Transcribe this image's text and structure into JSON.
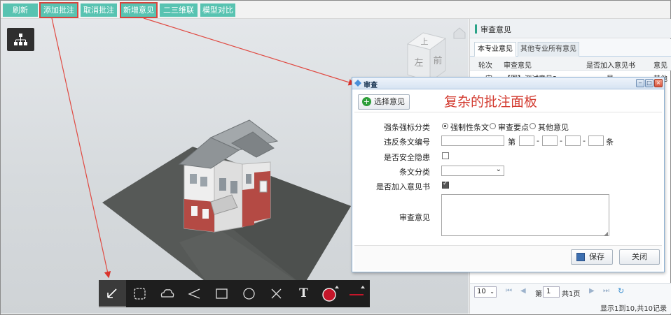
{
  "toolbar": {
    "buttons": [
      "刷新",
      "添加批注",
      "取消批注",
      "新增意见",
      "二三维联动",
      "模型对比"
    ],
    "accent": "#58c3b1",
    "highlight": "#d9453e"
  },
  "viewcube": {
    "top": "上",
    "left": "左",
    "front": "前"
  },
  "right_panel": {
    "title": "审查意见",
    "tabs": [
      "本专业意见",
      "其他专业所有意见"
    ],
    "columns": [
      "轮次",
      "审查意见",
      "是否加入意见书",
      "意见"
    ],
    "row": [
      "一审",
      "【图】测试意见2",
      "是",
      "其他"
    ],
    "pager": {
      "page_size": "10",
      "page_prefix": "第",
      "page_value": "1",
      "page_suffix": "共1页"
    },
    "status": "显示1到10,共10记录"
  },
  "dialog": {
    "title": "审查",
    "select_button": "选择意见",
    "annotation_note": "复杂的批注面板",
    "fields": {
      "category_label": "强条强标分类",
      "category_options": [
        "强制性条文",
        "审查要点",
        "其他意见"
      ],
      "clause_label": "违反条文编号",
      "clause_prefix": "第",
      "clause_sep": "-",
      "clause_suffix": "条",
      "safety_label": "是否安全隐患",
      "clause_type_label": "条文分类",
      "add_to_book_label": "是否加入意见书",
      "opinion_label": "审查意见"
    },
    "save_button": "保存",
    "close_button": "关闭"
  },
  "draw_tools": [
    "arrow",
    "lasso",
    "cloud",
    "polyline",
    "rectangle",
    "circle",
    "cross",
    "text",
    "color",
    "line-style"
  ],
  "draw_text_glyph": "T",
  "draw_color": "#c4162a"
}
